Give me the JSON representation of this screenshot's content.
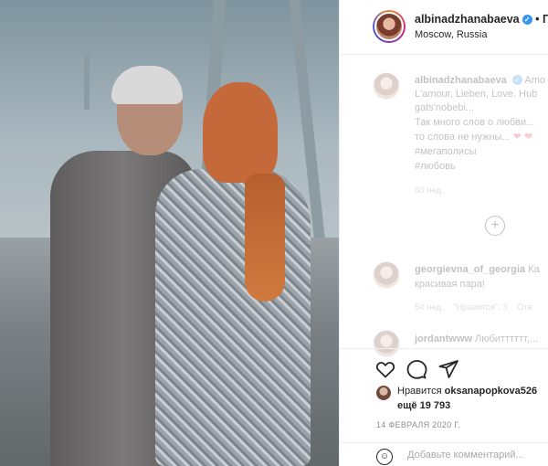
{
  "header": {
    "username": "albinadzhanabaeva",
    "follow_label": "• По",
    "location": "Moscow, Russia"
  },
  "caption": {
    "username": "albinadzhanabaeva",
    "line1_suffix": "Amo",
    "line2": "L'amour, Lieben, Love. Hub",
    "line3": "gats'nobebi...",
    "line4": "Так много слов о любви...",
    "line5": "то слова не нужны...",
    "hashtag1": "#мегаполисы",
    "hashtag2": "#любовь",
    "time": "60 нед."
  },
  "comments": [
    {
      "username": "georgievna_of_georgia",
      "text_inline": "Ка",
      "text_line2": "красивая пара!",
      "time": "54 нед.",
      "likes": "\"Нравится\": 3",
      "reply": "Отв"
    },
    {
      "username": "jordantwww",
      "text_inline": "Любитттттт,..."
    }
  ],
  "actions": {
    "likes_prefix": "Нравится",
    "likes_user": "oksanapopkova526",
    "likes_more": "ещё 19 793",
    "date": "14 ФЕВРАЛЯ 2020 Г.",
    "comment_placeholder": "Добавьте комментарий..."
  },
  "icons": [
    "heart-icon",
    "comment-icon",
    "share-icon",
    "verified-icon",
    "plus-circle-icon",
    "emoji-icon"
  ],
  "colors": {
    "verified": "#3897f0",
    "heart": "#ed4956",
    "muted": "#8e8e8e"
  }
}
